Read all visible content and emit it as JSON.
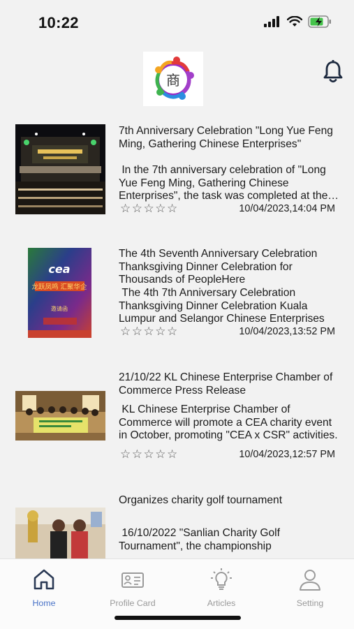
{
  "status_bar": {
    "time": "10:22",
    "battery": "charging"
  },
  "header": {
    "logo": "商",
    "notification_icon": "bell-icon"
  },
  "articles": [
    {
      "title": "7th Anniversary Celebration \"Long Yue Feng Ming, Gathering Chinese Enterprises\"",
      "description": " In the 7th anniversary celebration of \"Long Yue Feng Ming, Gathering Chinese Enterprises\", the task was completed at the event.",
      "rating": 0,
      "stars": "☆☆☆☆☆",
      "date": "10/04/2023,14:04 PM"
    },
    {
      "title": "The 4th Seventh Anniversary Celebration Thanksgiving Dinner Celebration for Thousands of PeopleHere",
      "description": " The 4th 7th Anniversary Celebration Thanksgiving Dinner Celebration Kuala Lumpur and Selangor Chinese Enterprises",
      "rating": 0,
      "stars": "☆☆☆☆☆",
      "date": "10/04/2023,13:52 PM",
      "poster_text": {
        "brand": "cea",
        "headline": "龙跃凤鸣 汇聚华企",
        "label": "邀请函"
      }
    },
    {
      "title": "21/10/22 KL Chinese Enterprise Chamber of Commerce Press Release",
      "description": " KL Chinese Enterprise Chamber of Commerce will promote a CEA charity event in October, promoting \"CEA x CSR\" activities.",
      "rating": 0,
      "stars": "☆☆☆☆☆",
      "date": "10/04/2023,12:57 PM"
    },
    {
      "title": "Organizes charity golf tournament",
      "description": " 16/10/2022 \"Sanlian Charity Golf Tournament\", the championship",
      "rating": 0,
      "stars": "☆☆☆☆☆",
      "date": ""
    }
  ],
  "tabbar": {
    "active": "Home",
    "tabs": [
      {
        "label": "Home",
        "icon": "home-icon"
      },
      {
        "label": "Profile Card",
        "icon": "id-card-icon"
      },
      {
        "label": "Articles",
        "icon": "lightbulb-icon"
      },
      {
        "label": "Setting",
        "icon": "person-icon"
      }
    ]
  },
  "colors": {
    "accent": "#4a73c7",
    "inactive": "#9a9a9a",
    "background": "#f2f2f2"
  }
}
